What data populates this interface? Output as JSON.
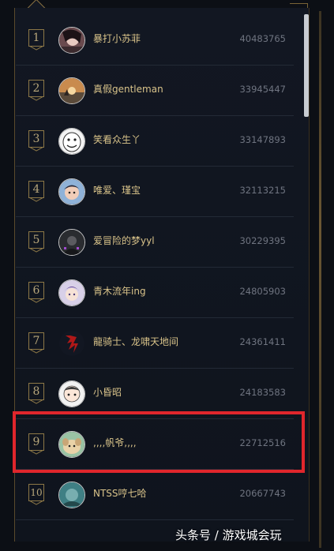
{
  "leaderboard": {
    "rows": [
      {
        "rank": "1",
        "name": "暴打小苏菲",
        "score": "40483765",
        "avatar": "avatar-dark-hair"
      },
      {
        "rank": "2",
        "name": "真假gentleman",
        "score": "33945447",
        "avatar": "avatar-sunset"
      },
      {
        "rank": "3",
        "name": "笑看众生丫",
        "score": "33147893",
        "avatar": "avatar-meme-face"
      },
      {
        "rank": "4",
        "name": "唯爱、瑾宝",
        "score": "32113215",
        "avatar": "avatar-child"
      },
      {
        "rank": "5",
        "name": "爱冒险的梦yyl",
        "score": "30229395",
        "avatar": "avatar-dark-figure"
      },
      {
        "rank": "6",
        "name": "青木流年ing",
        "score": "24805903",
        "avatar": "avatar-anime"
      },
      {
        "rank": "7",
        "name": "龍骑士、龙啸天地间",
        "score": "24361411",
        "avatar": "avatar-dragon-glyph"
      },
      {
        "rank": "8",
        "name": "小昏昭",
        "score": "24183583",
        "avatar": "avatar-cartoon"
      },
      {
        "rank": "9",
        "name": ",,,,帆爷,,,,",
        "score": "22712516",
        "avatar": "avatar-dog"
      },
      {
        "rank": "10",
        "name": "NTSS哼七哈",
        "score": "20667743",
        "avatar": "avatar-teal"
      }
    ],
    "highlighted_rank": "9"
  },
  "watermark": "头条号 / 游戏城会玩",
  "colors": {
    "accent_red": "#e0262c",
    "gold": "#8d7847",
    "name_text": "#d9c38a"
  }
}
